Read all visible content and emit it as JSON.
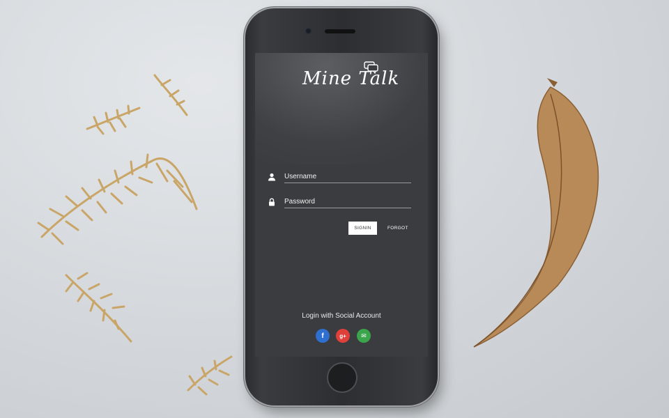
{
  "app": {
    "logo_text": "Mine Talk"
  },
  "login": {
    "username_placeholder": "Username",
    "password_placeholder": "Password",
    "signin_label": "SIGNIN",
    "forgot_label": "FORGOT"
  },
  "social": {
    "title": "Login with Social Account",
    "buttons": [
      {
        "name": "facebook",
        "glyph": "f",
        "color": "#2f6fd0"
      },
      {
        "name": "google-plus",
        "glyph": "g+",
        "color": "#e0403a"
      },
      {
        "name": "email",
        "glyph": "✉",
        "color": "#3aa54a"
      }
    ]
  },
  "colors": {
    "screen_bg": "#3a3c40",
    "signin_button_bg": "#ffffff"
  }
}
